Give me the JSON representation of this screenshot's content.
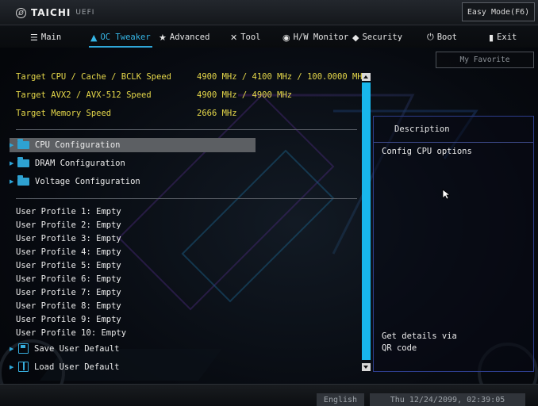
{
  "brand": {
    "name": "TAICHI",
    "sub": "UEFI",
    "mark": "Ø"
  },
  "easy_mode_label": "Easy Mode(F6)",
  "tabs": [
    {
      "label": "Main",
      "icon": "list-icon"
    },
    {
      "label": "OC Tweaker",
      "icon": "rocket-icon",
      "active": true
    },
    {
      "label": "Advanced",
      "icon": "advanced-icon"
    },
    {
      "label": "Tool",
      "icon": "tool-icon"
    },
    {
      "label": "H/W Monitor",
      "icon": "monitor-icon"
    },
    {
      "label": "Security",
      "icon": "shield-icon"
    },
    {
      "label": "Boot",
      "icon": "power-icon"
    },
    {
      "label": "Exit",
      "icon": "exit-icon"
    }
  ],
  "favorite_label": "My Favorite",
  "targets": [
    {
      "label": "Target CPU / Cache / BCLK Speed",
      "value": "4900 MHz / 4100 MHz / 100.0000 MHz"
    },
    {
      "label": "Target AVX2 / AVX-512 Speed",
      "value": "4900 MHz / 4900 MHz"
    },
    {
      "label": "Target Memory Speed",
      "value": "2666 MHz"
    }
  ],
  "menu": [
    {
      "label": "CPU Configuration",
      "selected": true
    },
    {
      "label": "DRAM Configuration"
    },
    {
      "label": "Voltage Configuration"
    }
  ],
  "profiles": [
    "User Profile 1: Empty",
    "User Profile 2: Empty",
    "User Profile 3: Empty",
    "User Profile 4: Empty",
    "User Profile 5: Empty",
    "User Profile 6: Empty",
    "User Profile 7: Empty",
    "User Profile 8: Empty",
    "User Profile 9: Empty",
    "User Profile 10: Empty"
  ],
  "actions": [
    {
      "label": "Save User Default",
      "icon": "save-icon"
    },
    {
      "label": "Load User Default",
      "icon": "load-icon"
    }
  ],
  "description": {
    "title": "Description",
    "text": "Config CPU options",
    "qr_text": "Get details via QR code"
  },
  "footer": {
    "language": "English",
    "datetime": "Thu 12/24/2099, 02:39:05"
  },
  "colors": {
    "accent": "#18b6ec",
    "target_text": "#e6d84a",
    "selected_row": "#5c5f63",
    "panel_border": "#2d3d8c"
  }
}
